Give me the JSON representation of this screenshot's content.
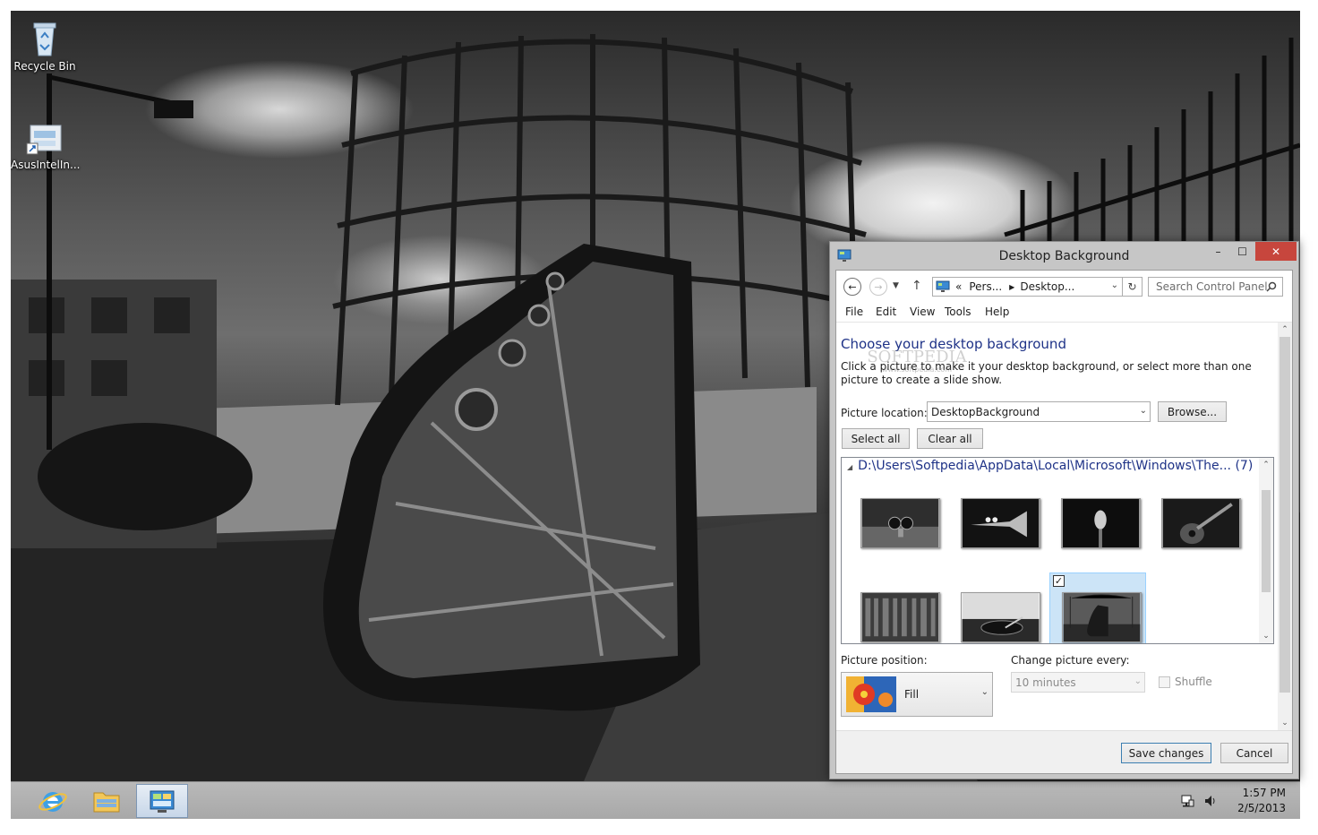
{
  "desktop": {
    "icons": [
      {
        "label": "Recycle Bin",
        "icon": "recycle-bin-icon"
      },
      {
        "label": "AsusIntelIn...",
        "icon": "shortcut-icon"
      }
    ]
  },
  "taskbar": {
    "pinned": [
      {
        "name": "internet-explorer",
        "icon": "internet-explorer-icon"
      },
      {
        "name": "file-explorer",
        "icon": "folder-icon"
      },
      {
        "name": "control-panel",
        "icon": "control-panel-icon",
        "active": true
      }
    ],
    "tray": [
      {
        "icon": "network-icon"
      },
      {
        "icon": "volume-icon"
      }
    ],
    "clock": {
      "time": "1:57 PM",
      "date": "2/5/2013"
    }
  },
  "window": {
    "title": "Desktop Background",
    "caption_buttons": {
      "minimize": "–",
      "maximize": "☐",
      "close": "✕"
    },
    "address": {
      "prefix": "«",
      "crumbs": [
        "Pers...",
        "Desktop..."
      ]
    },
    "search_placeholder": "Search Control Panel",
    "menu": [
      "File",
      "Edit",
      "View",
      "Tools",
      "Help"
    ],
    "heading": "Choose your desktop background",
    "intro": "Click a picture to make it your desktop background, or select more than one picture to create a slide show.",
    "watermark": {
      "text": "SOFTPEDIA",
      "url": "www.softpedia.com"
    },
    "picture_location": {
      "label": "Picture location:",
      "value": "DesktopBackground",
      "browse": "Browse..."
    },
    "select_all": "Select all",
    "clear_all": "Clear all",
    "group_header": "D:\\Users\\Softpedia\\AppData\\Local\\Microsoft\\Windows\\The... (7)",
    "pictures": [
      {
        "name": "binoculars",
        "checked": false
      },
      {
        "name": "trumpet",
        "checked": false
      },
      {
        "name": "microphone",
        "checked": false
      },
      {
        "name": "guitar",
        "checked": false
      },
      {
        "name": "vinyl-records",
        "checked": false
      },
      {
        "name": "turntable",
        "checked": false
      },
      {
        "name": "piano",
        "checked": true
      }
    ],
    "picture_position": {
      "label": "Picture position:",
      "value": "Fill"
    },
    "change_picture": {
      "label": "Change picture every:",
      "value": "10 minutes"
    },
    "shuffle": {
      "label": "Shuffle",
      "checked": false
    },
    "save": "Save changes",
    "cancel": "Cancel"
  }
}
